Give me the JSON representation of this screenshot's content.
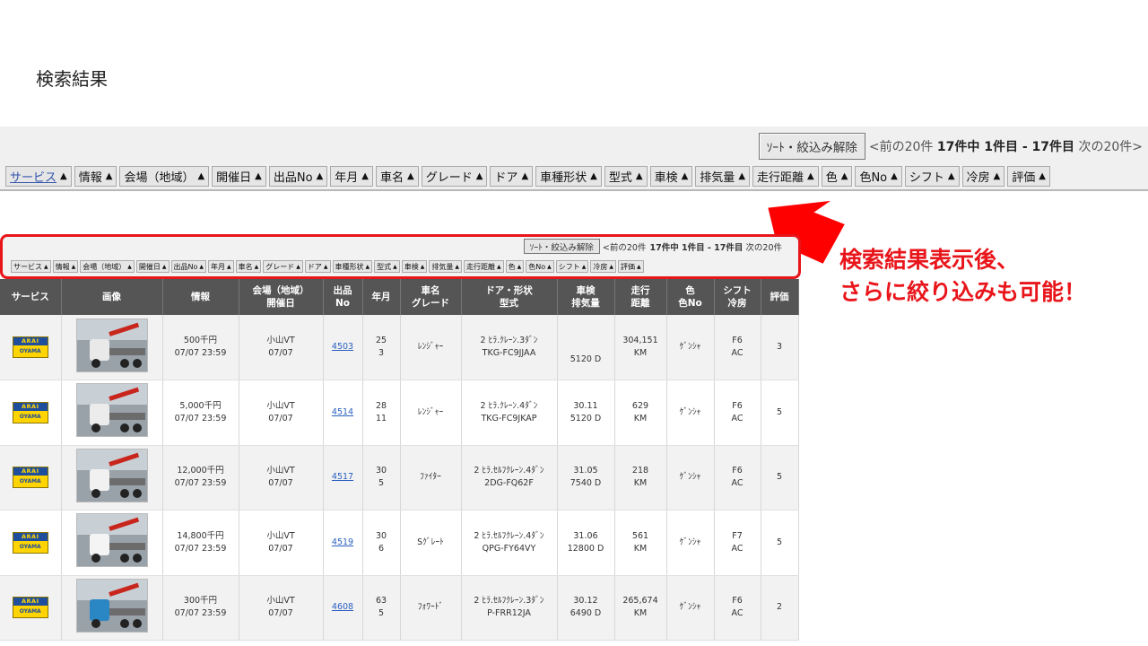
{
  "slide_title": "検索結果",
  "callout": {
    "line1": "検索結果表示後、",
    "line2": "さらに絞り込みも可能！",
    "color": "#e8151b"
  },
  "big_bar": {
    "reset_label": "ｿｰﾄ・絞込み解除",
    "prev": "<前の20件",
    "count_label": "17件中 1件目 - 17件目",
    "next": "次の20件>",
    "sorts": [
      "サービス",
      "情報",
      "会場（地域）",
      "開催日",
      "出品No",
      "年月",
      "車名",
      "グレード",
      "ドア",
      "車種形状",
      "型式",
      "車検",
      "排気量",
      "走行距離",
      "色",
      "色No",
      "シフト",
      "冷房",
      "評価"
    ],
    "arrow": "▲"
  },
  "small_bar": {
    "reset_label": "ｿｰﾄ・絞込み解除",
    "prev": "<前の20件",
    "count_label": "17件中 1件目 - 17件目",
    "next": "次の20件",
    "sorts": [
      "サービス",
      "情報",
      "会場（地域）",
      "開催日",
      "出品No",
      "年月",
      "車名",
      "グレード",
      "ドア",
      "車種形状",
      "型式",
      "車検",
      "排気量",
      "走行距離",
      "色",
      "色No",
      "シフト",
      "冷房",
      "評価"
    ],
    "arrow": "▲"
  },
  "table": {
    "headers": [
      [
        "サービス",
        ""
      ],
      [
        "画像",
        ""
      ],
      [
        "情報",
        ""
      ],
      [
        "会場（地域）",
        "開催日"
      ],
      [
        "出品",
        "No"
      ],
      [
        "年月",
        ""
      ],
      [
        "車名",
        "グレード"
      ],
      [
        "ドア・形状",
        "型式"
      ],
      [
        "車検",
        "排気量"
      ],
      [
        "走行",
        "距離"
      ],
      [
        "色",
        "色No"
      ],
      [
        "シフト",
        "冷房"
      ],
      [
        "評価",
        ""
      ]
    ],
    "logo_top": "ARAI",
    "logo_bottom": "OYAMA",
    "rows": [
      {
        "info1": "500千円",
        "info2": "07/07 23:59",
        "venue1": "小山VT",
        "venue2": "07/07",
        "lot": "4503",
        "ym1": "25",
        "ym2": "3",
        "name": "ﾚﾝｼﾞｬｰ",
        "door1": "2 ﾋﾗ.ｸﾚｰﾝ.3ﾀﾞﾝ",
        "door2": "TKG-FC9JJAA",
        "insp1": "",
        "insp2": "5120 D",
        "dist1": "304,151",
        "dist2": "KM",
        "color": "ｹﾞﾝｼｬ",
        "shift1": "F6",
        "shift2": "AC",
        "grade": "3",
        "cab": "#e9e9e9"
      },
      {
        "info1": "5,000千円",
        "info2": "07/07 23:59",
        "venue1": "小山VT",
        "venue2": "07/07",
        "lot": "4514",
        "ym1": "28",
        "ym2": "11",
        "name": "ﾚﾝｼﾞｬｰ",
        "door1": "2 ﾋﾗ.ｸﾚｰﾝ.4ﾀﾞﾝ",
        "door2": "TKG-FC9JKAP",
        "insp1": "30.11",
        "insp2": "5120 D",
        "dist1": "629",
        "dist2": "KM",
        "color": "ｹﾞﾝｼｬ",
        "shift1": "F6",
        "shift2": "AC",
        "grade": "5",
        "cab": "#ececec"
      },
      {
        "info1": "12,000千円",
        "info2": "07/07 23:59",
        "venue1": "小山VT",
        "venue2": "07/07",
        "lot": "4517",
        "ym1": "30",
        "ym2": "5",
        "name": "ﾌｧｲﾀｰ",
        "door1": "2 ﾋﾗ.ｾﾙﾌｸﾚｰﾝ.4ﾀﾞﾝ",
        "door2": "2DG-FQ62F",
        "insp1": "31.05",
        "insp2": "7540 D",
        "dist1": "218",
        "dist2": "KM",
        "color": "ｹﾞﾝｼｬ",
        "shift1": "F6",
        "shift2": "AC",
        "grade": "5",
        "cab": "#f1f1f1"
      },
      {
        "info1": "14,800千円",
        "info2": "07/07 23:59",
        "venue1": "小山VT",
        "venue2": "07/07",
        "lot": "4519",
        "ym1": "30",
        "ym2": "6",
        "name": "Sｸﾞﾚｰﾄ",
        "door1": "2 ﾋﾗ.ｾﾙﾌｸﾚｰﾝ.4ﾀﾞﾝ",
        "door2": "QPG-FY64VY",
        "insp1": "31.06",
        "insp2": "12800 D",
        "dist1": "561",
        "dist2": "KM",
        "color": "ｹﾞﾝｼｬ",
        "shift1": "F7",
        "shift2": "AC",
        "grade": "5",
        "cab": "#f4f4f4"
      },
      {
        "info1": "300千円",
        "info2": "07/07 23:59",
        "venue1": "小山VT",
        "venue2": "07/07",
        "lot": "4608",
        "ym1": "63",
        "ym2": "5",
        "name": "ﾌｫﾜｰﾄﾞ",
        "door1": "2 ﾋﾗ.ｾﾙﾌｸﾚｰﾝ.3ﾀﾞﾝ",
        "door2": "P-FRR12JA",
        "insp1": "30.12",
        "insp2": "6490 D",
        "dist1": "265,674",
        "dist2": "KM",
        "color": "ｹﾞﾝｼｬ",
        "shift1": "F6",
        "shift2": "AC",
        "grade": "2",
        "cab": "#2b86c4"
      }
    ]
  }
}
